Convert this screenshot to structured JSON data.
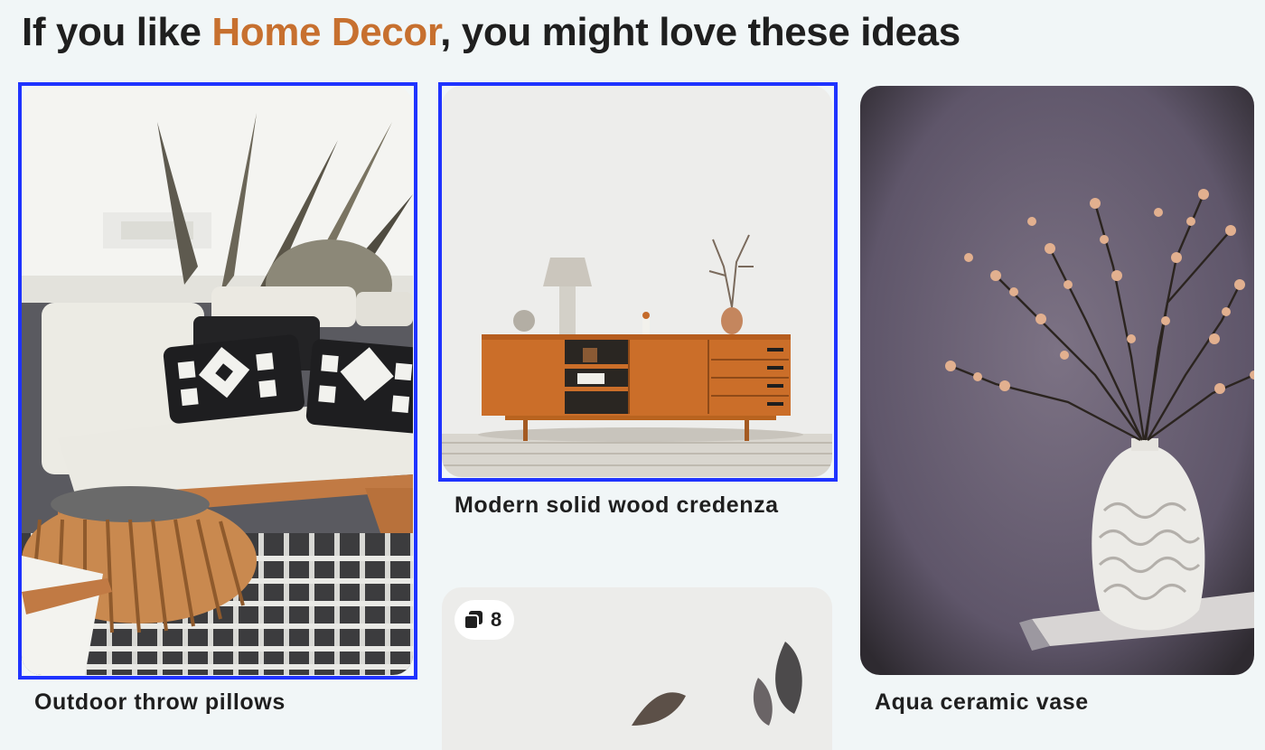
{
  "heading": {
    "prefix": "If you like ",
    "topic": "Home Decor",
    "suffix": ", you might love these ideas"
  },
  "pins": [
    {
      "title": "Outdoor throw pillows",
      "selected": true
    },
    {
      "title": "Modern solid wood credenza",
      "selected": true
    },
    {
      "title": "Aqua ceramic vase",
      "selected": false
    },
    {
      "title": "",
      "selected": false,
      "collection_count": "8",
      "collection_icon": "stacked-pages-icon"
    }
  ],
  "colors": {
    "background": "#f1f6f7",
    "accent": "#c7702f",
    "selection": "#1f33ff"
  }
}
